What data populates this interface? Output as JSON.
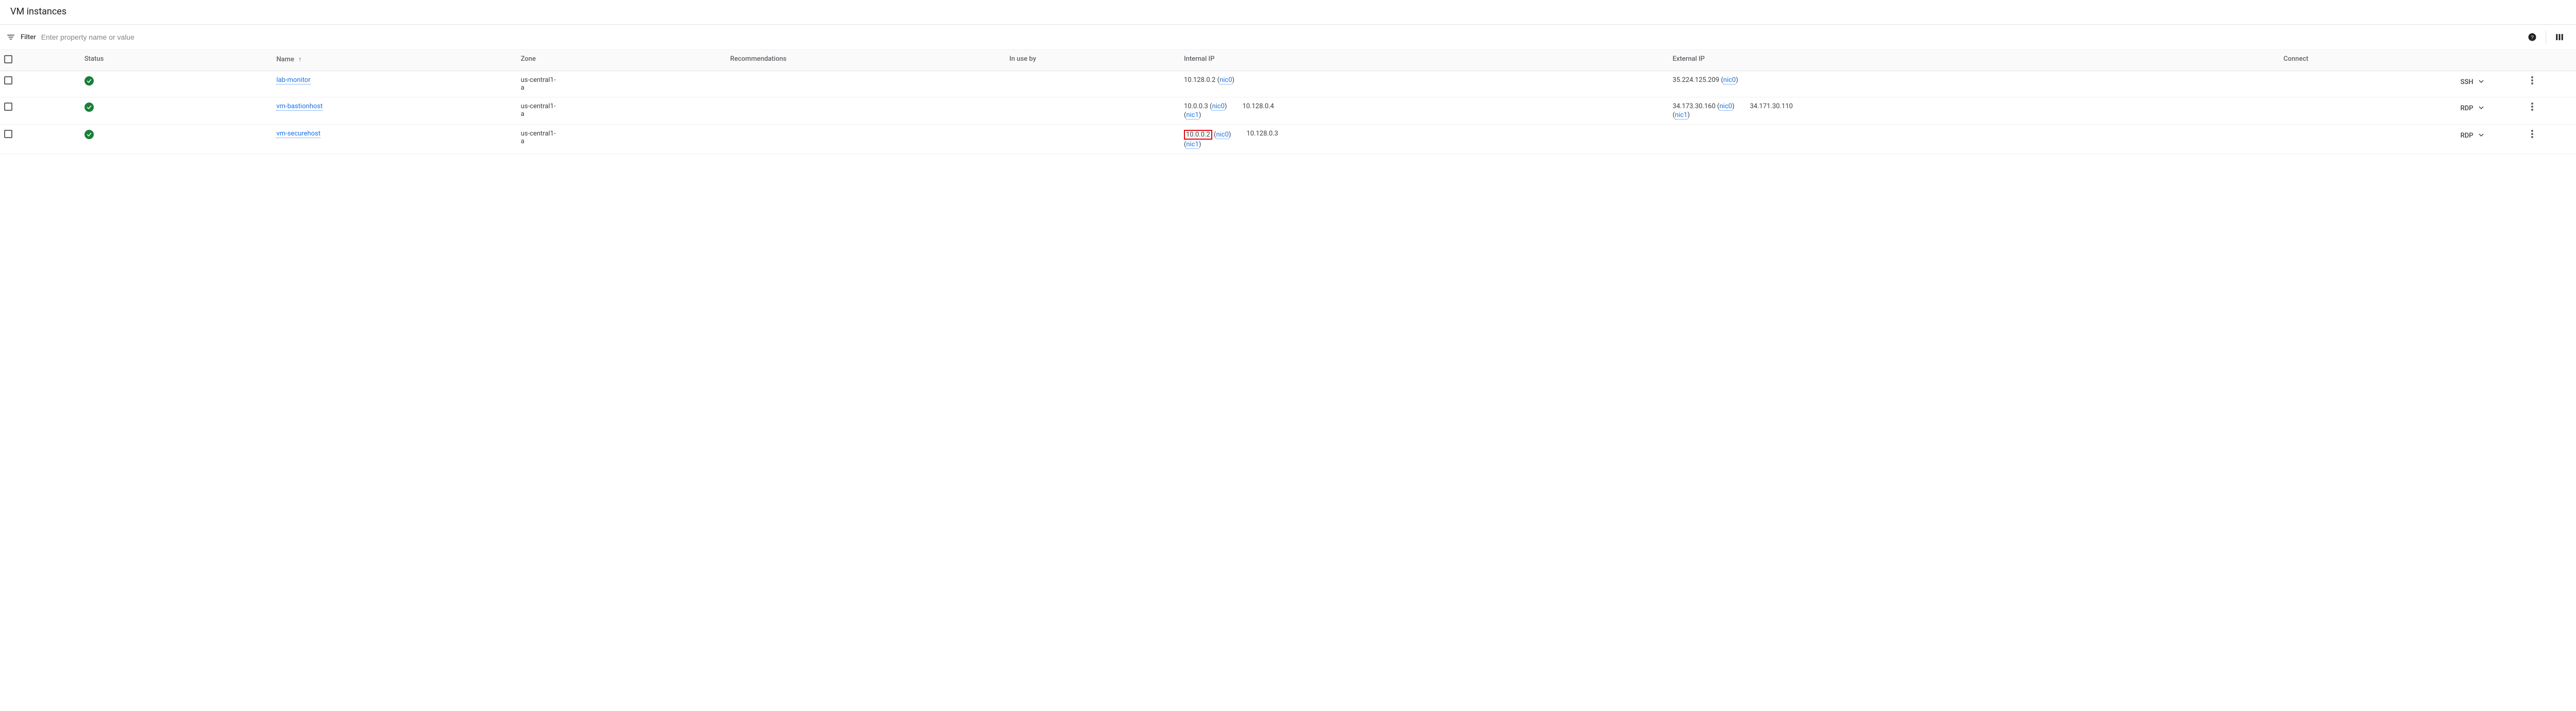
{
  "header": {
    "title": "VM instances"
  },
  "filter": {
    "label": "Filter",
    "placeholder": "Enter property name or value"
  },
  "columns": {
    "status": "Status",
    "name": "Name",
    "zone": "Zone",
    "recommendations": "Recommendations",
    "in_use_by": "In use by",
    "internal_ip": "Internal IP",
    "external_ip": "External IP",
    "connect": "Connect"
  },
  "icons": {
    "sort_asc": "↑",
    "caret_down": "▼",
    "more": "⋮"
  },
  "connect_labels": {
    "ssh": "SSH",
    "rdp": "RDP"
  },
  "rows": [
    {
      "name": "lab-monitor",
      "zone": "us-central1-a",
      "internal": {
        "a_ip": "10.128.0.2",
        "a_nic": "nic0",
        "a_highlight": false,
        "b_ip": "",
        "b_nic": "",
        "second_col": ""
      },
      "external": {
        "a_ip": "35.224.125.209",
        "a_nic": "nic0",
        "b_ip": "",
        "b_nic": "",
        "second_col": ""
      },
      "connect": "SSH"
    },
    {
      "name": "vm-bastionhost",
      "zone": "us-central1-a",
      "internal": {
        "a_ip": "10.0.0.3",
        "a_nic": "nic0",
        "a_highlight": false,
        "b_ip": "",
        "b_nic": "nic1",
        "second_col": "10.128.0.4"
      },
      "external": {
        "a_ip": "34.173.30.160",
        "a_nic": "nic0",
        "b_ip": "",
        "b_nic": "nic1",
        "second_col": "34.171.30.110"
      },
      "connect": "RDP"
    },
    {
      "name": "vm-securehost",
      "zone": "us-central1-a",
      "internal": {
        "a_ip": "10.0.0.2",
        "a_nic": "nic0",
        "a_highlight": true,
        "b_ip": "",
        "b_nic": "nic1",
        "second_col": "10.128.0.3"
      },
      "external": {
        "a_ip": "",
        "a_nic": "",
        "b_ip": "",
        "b_nic": "",
        "second_col": ""
      },
      "connect": "RDP"
    }
  ]
}
